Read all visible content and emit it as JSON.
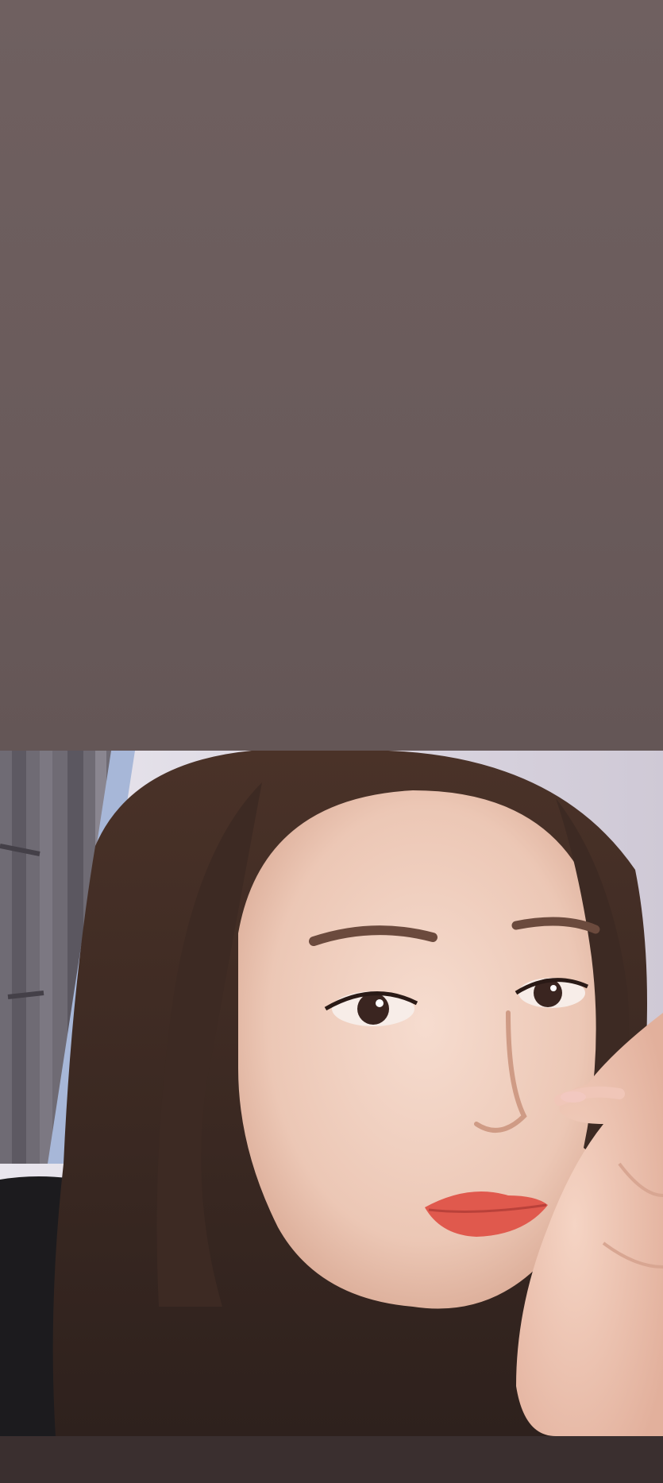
{
  "screen": {
    "type": "story-viewer",
    "background_color": "#6b5d5d",
    "bottom_bar_color": "#3a2f2f"
  },
  "photo": {
    "subject": "selfie-portrait",
    "dominant_colors": [
      "#3e2c25",
      "#f1d2c2",
      "#e0594d",
      "#1b1b1d",
      "#d9d4dc"
    ]
  }
}
